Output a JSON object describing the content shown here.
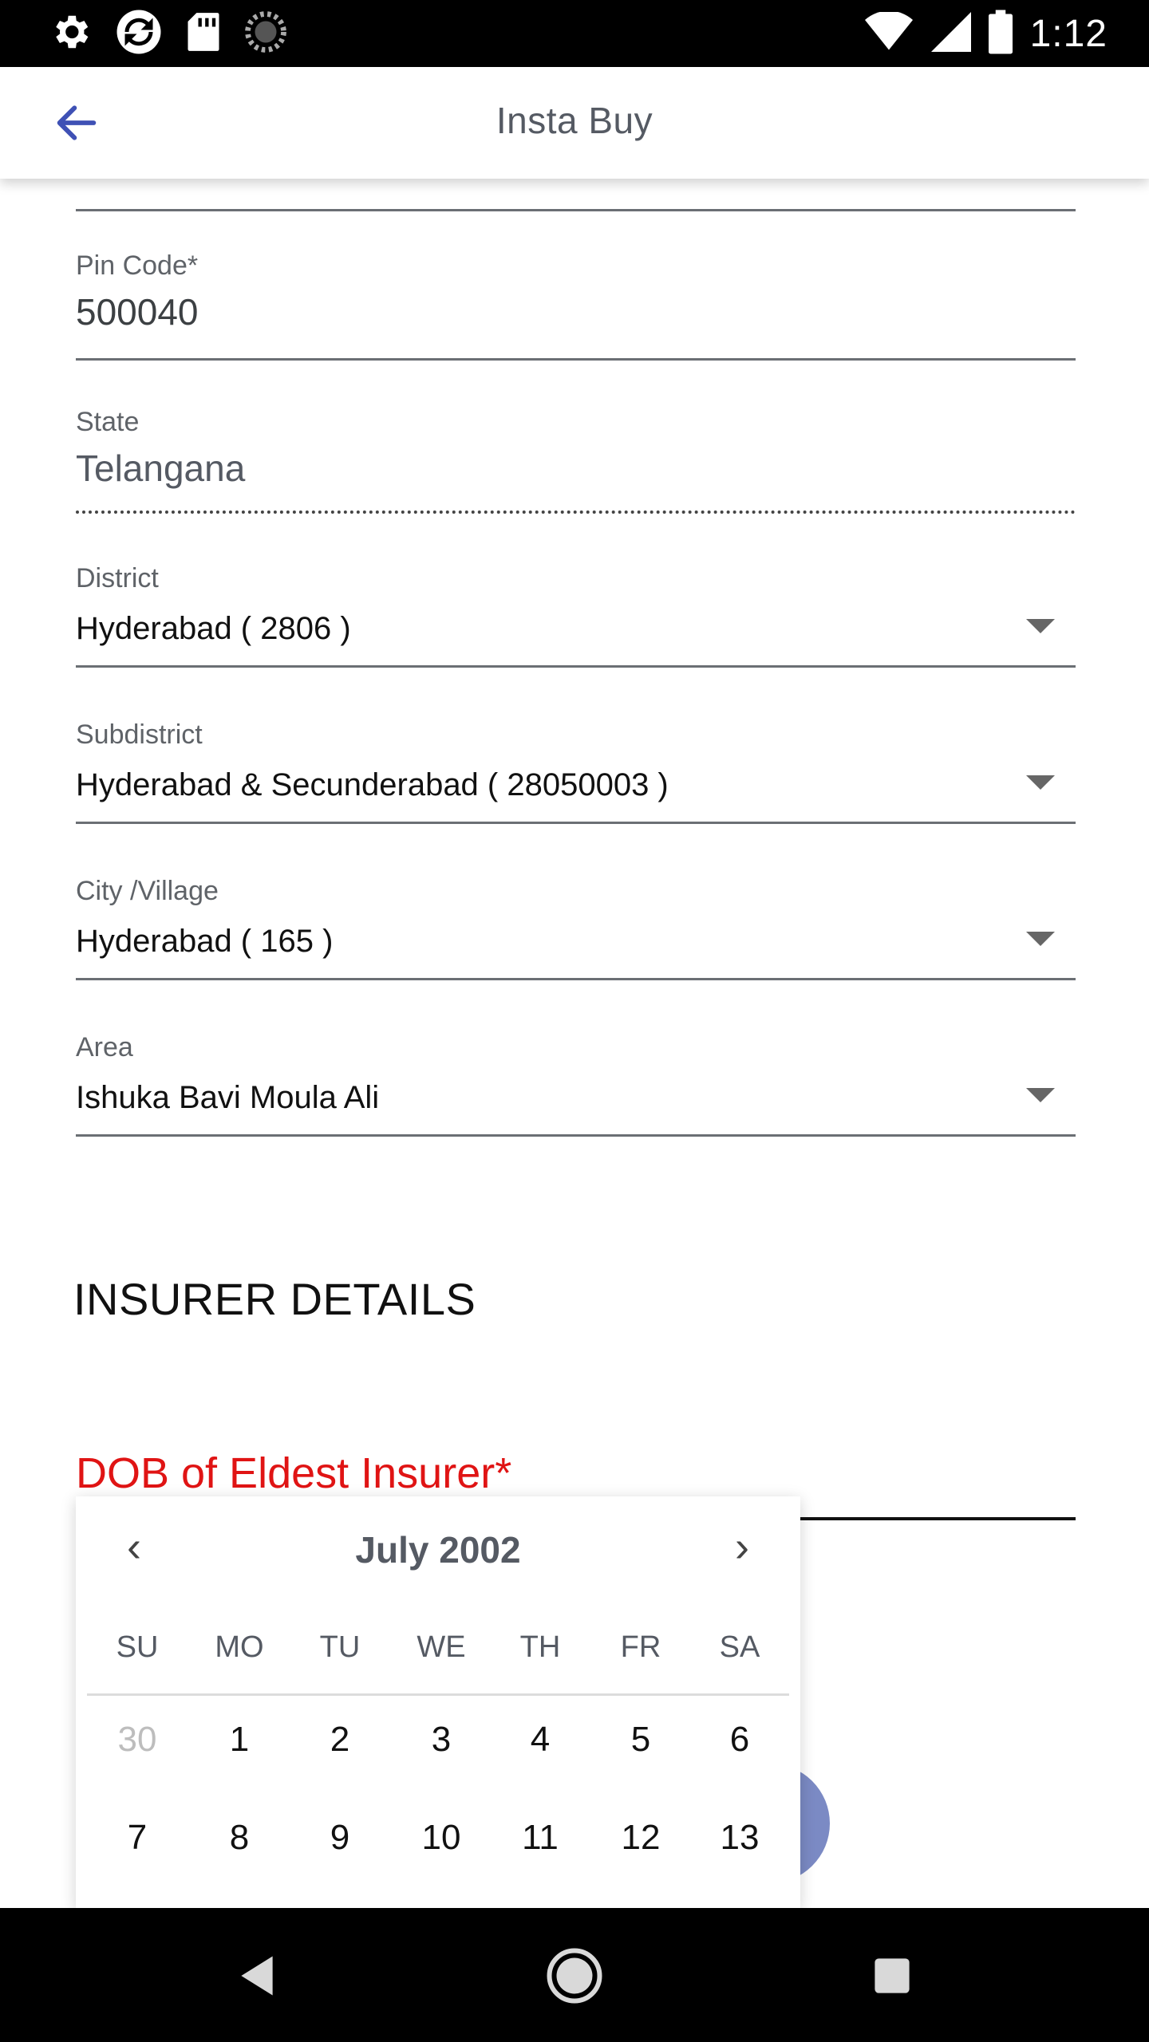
{
  "status_bar": {
    "time": "1:12",
    "left_icons": [
      "settings-icon",
      "sync-icon",
      "sd-card-icon",
      "loading-icon"
    ],
    "right_icons": [
      "wifi-icon",
      "signal-icon",
      "battery-icon"
    ]
  },
  "app_bar": {
    "title": "Insta Buy",
    "back_icon": "arrow-left-icon",
    "accent_color": "#3f51b5"
  },
  "form": {
    "pin_code": {
      "label": "Pin Code*",
      "value": "500040"
    },
    "state": {
      "label": "State",
      "value": "Telangana"
    },
    "district": {
      "label": "District",
      "value": "Hyderabad ( 2806 )"
    },
    "subdistrict": {
      "label": "Subdistrict",
      "value": "Hyderabad & Secunderabad ( 28050003 )"
    },
    "city": {
      "label": "City /Village",
      "value": "Hyderabad ( 165 )"
    },
    "area": {
      "label": "Area",
      "value": "Ishuka Bavi Moula Ali"
    }
  },
  "insurer": {
    "heading": "INSURER DETAILS",
    "dob_label": "DOB of Eldest Insurer*",
    "error_color": "#e01414"
  },
  "calendar": {
    "title": "July 2002",
    "prev": "‹",
    "next": "›",
    "weekdays": [
      "SU",
      "MO",
      "TU",
      "WE",
      "TH",
      "FR",
      "SA"
    ],
    "weeks": [
      [
        "30",
        "1",
        "2",
        "3",
        "4",
        "5",
        "6"
      ],
      [
        "7",
        "8",
        "9",
        "10",
        "11",
        "12",
        "13"
      ]
    ]
  },
  "nav_bar": {
    "icons": [
      "back-triangle-icon",
      "home-circle-icon",
      "recents-square-icon"
    ]
  }
}
